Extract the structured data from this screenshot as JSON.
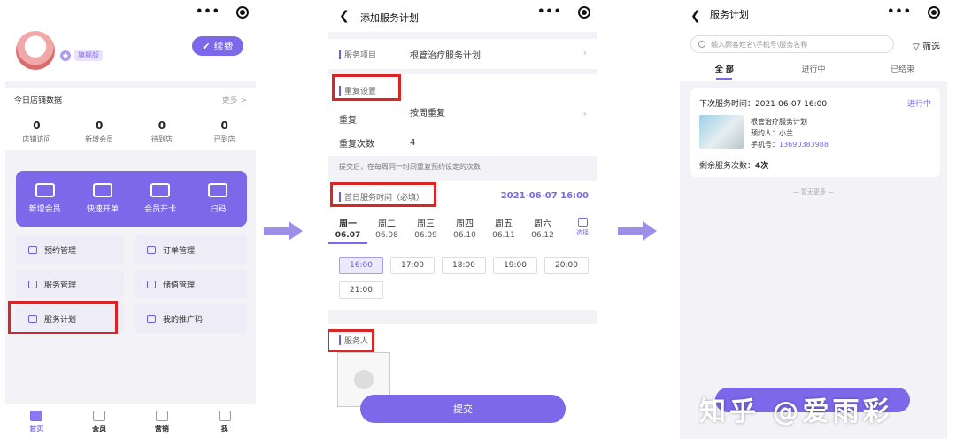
{
  "status_bar": {
    "dots": "•••"
  },
  "home": {
    "vip_tag": "旗舰版",
    "renew_label": "续费",
    "stats_title": "今日店铺数据",
    "stats_more": "更多 >",
    "stats": [
      {
        "value": "0",
        "label": "店铺访问"
      },
      {
        "value": "0",
        "label": "新增会员"
      },
      {
        "value": "0",
        "label": "待到店"
      },
      {
        "value": "0",
        "label": "已到店"
      }
    ],
    "quick_actions": [
      "新增会员",
      "快速开单",
      "会员开卡",
      "扫码"
    ],
    "menu": [
      "预约管理",
      "订单管理",
      "服务管理",
      "储值管理",
      "服务计划",
      "我的推广码"
    ],
    "tabs": [
      "首页",
      "会员",
      "营销",
      "我"
    ]
  },
  "add_plan": {
    "title": "添加服务计划",
    "service_item_label": "服务项目",
    "service_item_value": "根管治疗服务计划",
    "repeat_section": "重复设置",
    "repeat_label": "重复",
    "repeat_value": "按周重复",
    "repeat_count_label": "重复次数",
    "repeat_count_value": "4",
    "note": "提交后，在每周同一时间重复预约设定的次数",
    "first_time_label": "首日服务时间（必填）",
    "first_time_value": "2021-06-07 16:00",
    "weekdays": [
      {
        "w": "周一",
        "d": "06.07"
      },
      {
        "w": "周二",
        "d": "06.08"
      },
      {
        "w": "周三",
        "d": "06.09"
      },
      {
        "w": "周四",
        "d": "06.10"
      },
      {
        "w": "周五",
        "d": "06.11"
      },
      {
        "w": "周六",
        "d": "06.12"
      }
    ],
    "week_pick": "选择",
    "slots": [
      "16:00",
      "17:00",
      "18:00",
      "19:00",
      "20:00",
      "21:00"
    ],
    "server_label": "服务人",
    "submit": "提交"
  },
  "plan_list": {
    "title": "服务计划",
    "search_placeholder": "输入顾客姓名\\手机号\\服务名称",
    "filter": "筛选",
    "tabs": [
      "全 部",
      "进行中",
      "已结束"
    ],
    "card": {
      "next_time": "下次服务时间：2021-06-07 16:00",
      "status": "进行中",
      "plan_name": "根管治疗服务计划",
      "reserver": "预约人：小兰",
      "phone_label": "手机号：",
      "phone": "13690383988",
      "remain_label": "剩余服务次数：",
      "remain_value": "4次"
    },
    "no_more": "— 暂无更多 —"
  },
  "watermark": "知乎 @爱雨彩",
  "colors": {
    "accent": "#7c68e8",
    "highlight": "#d92525"
  }
}
